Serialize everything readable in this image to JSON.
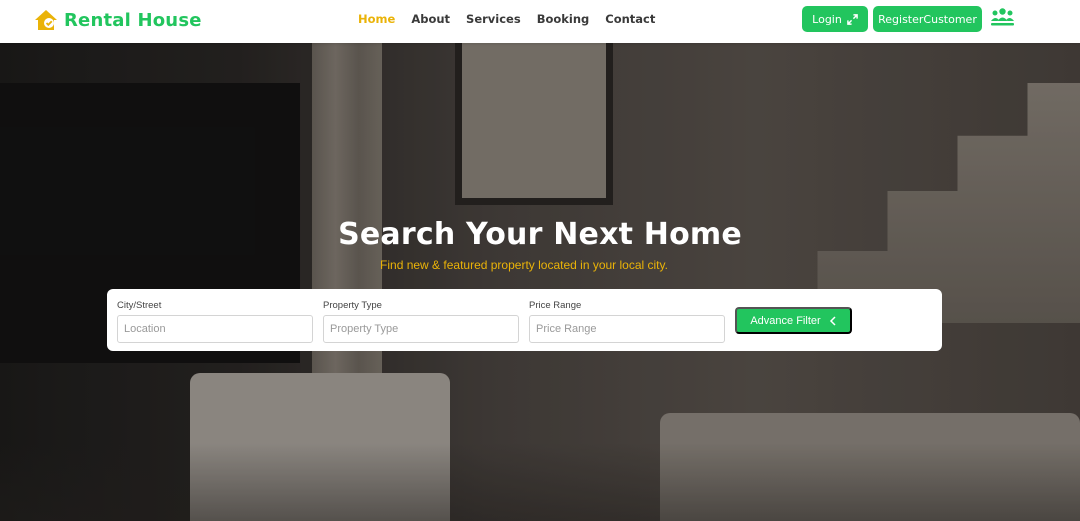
{
  "brand": {
    "name": "Rental House",
    "icon": "house-icon"
  },
  "nav": {
    "home": "Home",
    "about": "About",
    "services": "Services",
    "booking": "Booking",
    "contact": "Contact"
  },
  "actions": {
    "login": "Login",
    "login_icon": "expand-arrows-icon",
    "register": "RegisterCustomer",
    "users_icon": "users-icon"
  },
  "hero": {
    "title": "Search Your Next Home",
    "subtitle": "Find new & featured property located in your local city."
  },
  "search": {
    "city_label": "City/Street",
    "city_placeholder": "Location",
    "type_label": "Property Type",
    "type_placeholder": "Property Type",
    "price_label": "Price Range",
    "price_placeholder": "Price Range",
    "filter_button": "Advance Filter",
    "filter_icon": "chevron-left-icon"
  },
  "colors": {
    "accent": "#22c55e",
    "active_nav": "#eab308",
    "subtitle": "#eab308"
  }
}
